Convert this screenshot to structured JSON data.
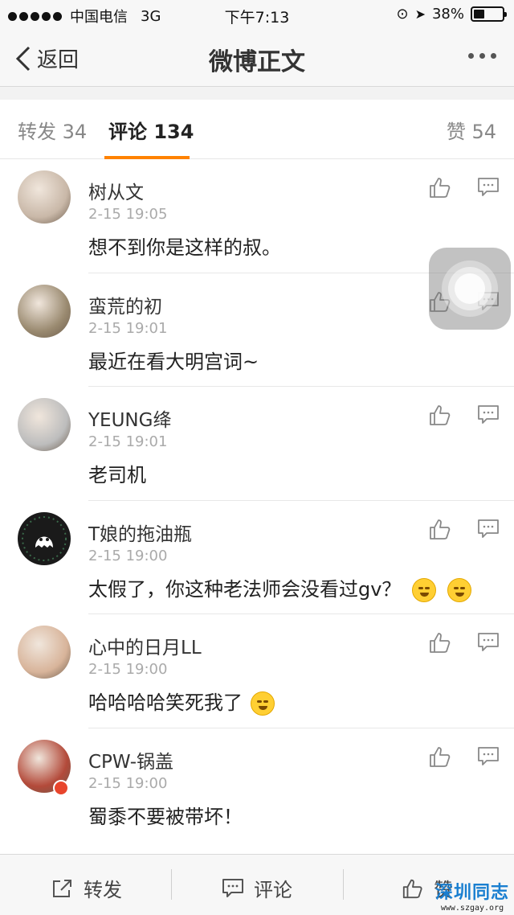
{
  "status_bar": {
    "carrier": "中国电信",
    "network": "3G",
    "time": "下午7:13",
    "battery": "38%",
    "battery_level": 0.38
  },
  "nav": {
    "back_label": "返回",
    "title": "微博正文"
  },
  "tabs": {
    "repost": "转发 34",
    "comment": "评论 134",
    "like": "赞 54"
  },
  "comments": [
    {
      "name": "树从文",
      "time": "2-15 19:05",
      "text": "想不到你是这样的叔。",
      "avatar_color": "#c9b8a8"
    },
    {
      "name": "蛮荒的初",
      "time": "2-15 19:01",
      "text": "最近在看大明宫词~",
      "avatar_color": "#9a8a70"
    },
    {
      "name": "YEUNG绛",
      "time": "2-15 19:01",
      "text": "老司机",
      "avatar_color": "#bdbdbd"
    },
    {
      "name": "T娘的拖油瓶",
      "time": "2-15 19:00",
      "text": "太假了，你这种老法师会没看过gv？",
      "avatar_color": "#1a1a1a",
      "emojis": [
        "shy-face-icon",
        "sly-face-icon"
      ]
    },
    {
      "name": "心中的日月LL",
      "time": "2-15 19:00",
      "text": "哈哈哈哈笑死我了",
      "avatar_color": "#d8b49a",
      "emojis": [
        "laugh-cry-icon"
      ]
    },
    {
      "name": "CPW-锅盖",
      "time": "2-15 19:00",
      "text": "蜀黍不要被带坏！",
      "avatar_color": "#b34a3a"
    }
  ],
  "toolbar": {
    "repost": "转发",
    "comment": "评论",
    "like": "赞"
  },
  "watermark": {
    "title": "深圳同志",
    "url": "www.szgay.org"
  },
  "colors": {
    "accent": "#ff8200",
    "watermark": "#1a7fd0"
  }
}
